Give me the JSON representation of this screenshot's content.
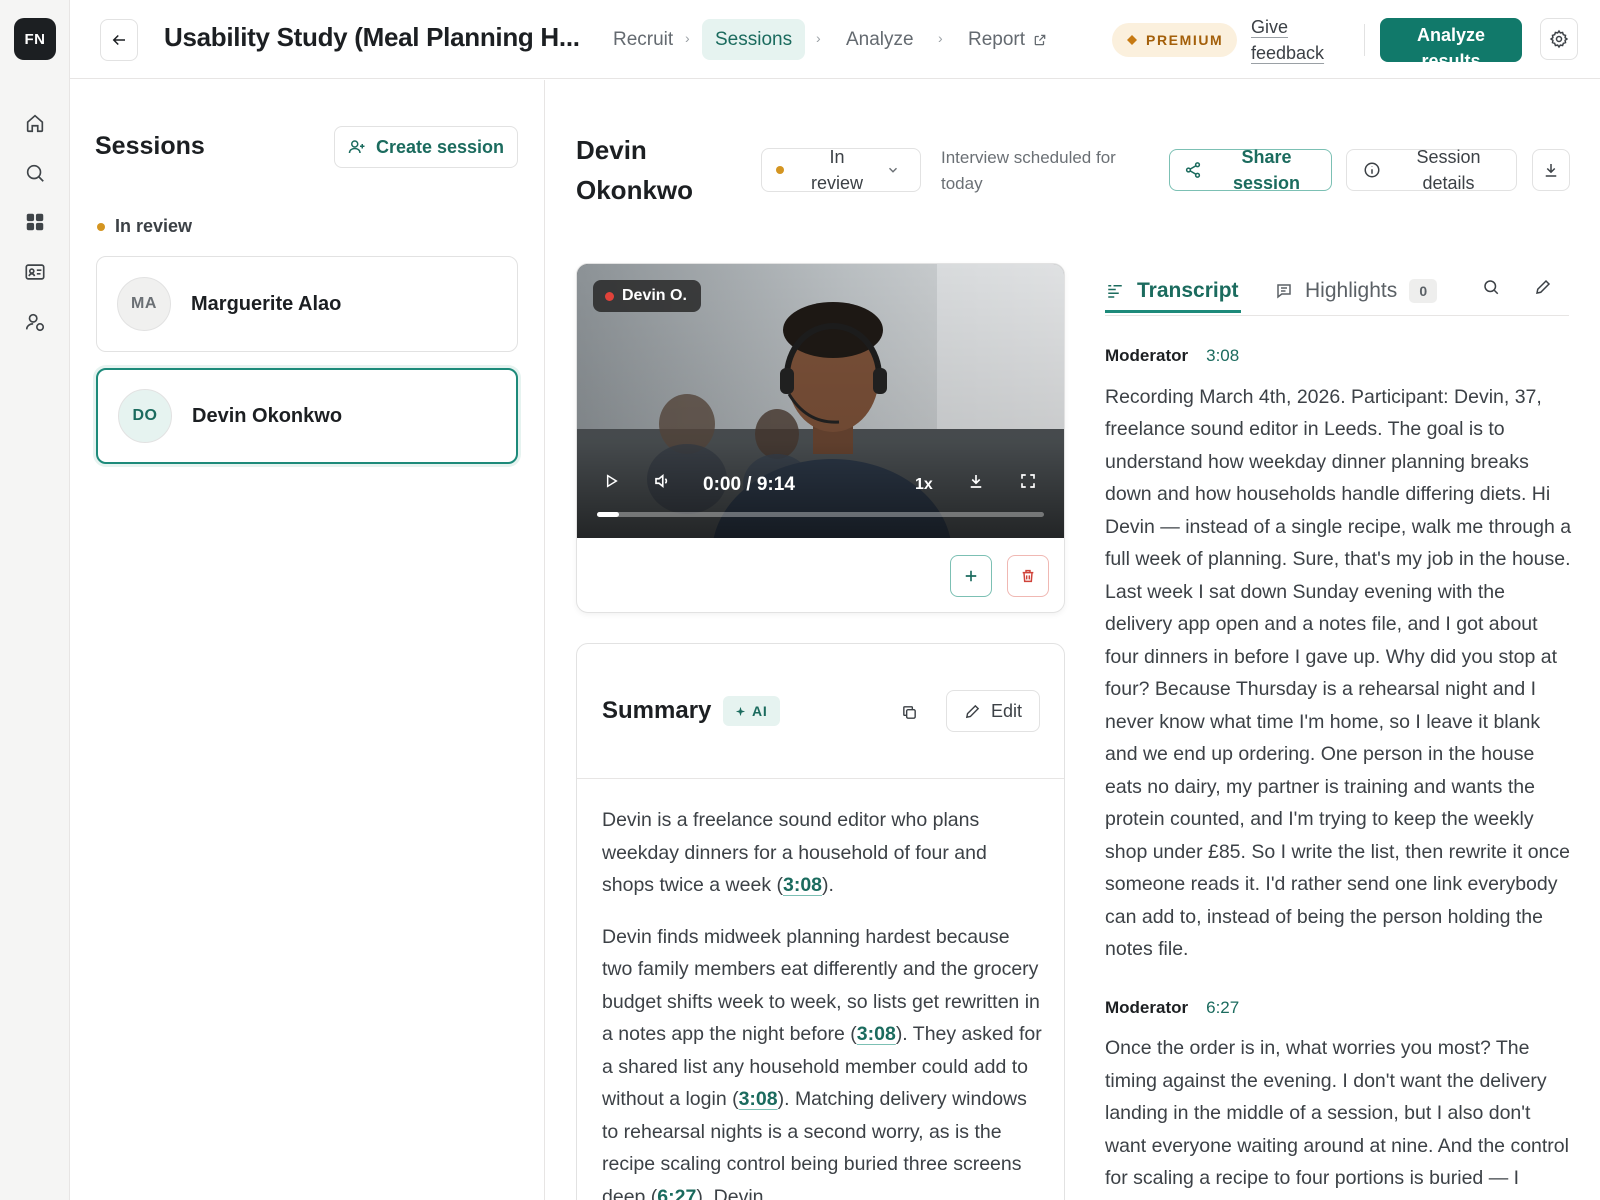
{
  "rail": {
    "logo": "FN",
    "items": [
      {
        "icon": "home-icon"
      },
      {
        "icon": "search-icon"
      },
      {
        "icon": "grid-icon"
      },
      {
        "icon": "id-card-icon"
      },
      {
        "icon": "user-settings-icon"
      }
    ]
  },
  "topbar": {
    "study_title": "Usability Study (Meal Planning H...",
    "steps": [
      "Recruit",
      "Sessions",
      "Analyze",
      "Report"
    ],
    "active_step": "Sessions",
    "premium_label": "PREMIUM",
    "feedback_line1": "Give",
    "feedback_line2": "feedback",
    "analyze_line1": "Analyze",
    "analyze_line2": "results"
  },
  "sessions": {
    "title": "Sessions",
    "create_label": "Create session",
    "group_label": "In review",
    "items": [
      {
        "initials": "MA",
        "name": "Marguerite Alao",
        "selected": false
      },
      {
        "initials": "DO",
        "name": "Devin Okonkwo",
        "selected": true
      }
    ]
  },
  "header": {
    "first_name": "Devin",
    "last_name": "Okonkwo",
    "status_line1": "In",
    "status_line2": "review",
    "scheduled": "Interview scheduled for today",
    "share_line1": "Share",
    "share_line2": "session",
    "details_line1": "Session",
    "details_line2": "details"
  },
  "video": {
    "tag": "Devin O.",
    "time": "0:00 / 9:14",
    "speed": "1x",
    "progress_fraction": 0.02
  },
  "summary": {
    "title": "Summary",
    "ai_label": "AI",
    "edit_label": "Edit",
    "p1_a": "Devin is a freelance sound editor who plans weekday dinners for a household of four and shops twice a week (",
    "p1_ts": "3:08",
    "p1_b": ").",
    "p2_a": "Devin finds midweek planning hardest because two family members eat differently and the grocery budget shifts week to week, so lists get rewritten in a notes app the night before (",
    "p2_ts1": "3:08",
    "p2_b": "). They asked for a shared list any household member could add to without a login (",
    "p2_ts2": "3:08",
    "p2_c": "). Matching delivery windows to rehearsal nights is a second worry, as is the recipe scaling control being buried three screens deep (",
    "p2_ts3": "6:27",
    "p2_d": "). Devin"
  },
  "transcript": {
    "tab_transcript": "Transcript",
    "tab_highlights": "Highlights",
    "highlights_count": "0",
    "entries": [
      {
        "speaker": "Moderator",
        "time": "3:08",
        "text": "Recording March 4th, 2026. Participant: Devin, 37, freelance sound editor in Leeds. The goal is to understand how weekday dinner planning breaks down and how households handle differing diets. Hi Devin — instead of a single recipe, walk me through a full week of planning. Sure, that's my job in the house. Last week I sat down Sunday evening with the delivery app open and a notes file, and I got about four dinners in before I gave up. Why did you stop at four? Because Thursday is a rehearsal night and I never know what time I'm home, so I leave it blank and we end up ordering. One person in the house eats no dairy, my partner is training and wants the protein counted, and I'm trying to keep the weekly shop under £85. So I write the list, then rewrite it once someone reads it. I'd rather send one link everybody can add to, instead of being the person holding the notes file."
      },
      {
        "speaker": "Moderator",
        "time": "6:27",
        "text": "Once the order is in, what worries you most? The timing against the evening. I don't want the delivery landing in the middle of a session, but I also don't want everyone waiting around at nine. And the control for scaling a recipe to four portions is buried — I usually give up and just double things."
      }
    ]
  },
  "colors": {
    "accent": "#11796a",
    "accent_light": "#e6f3f0",
    "premium_bg": "#fbf0dd",
    "status_dot": "#d49521",
    "rec_dot": "#e0423a"
  }
}
